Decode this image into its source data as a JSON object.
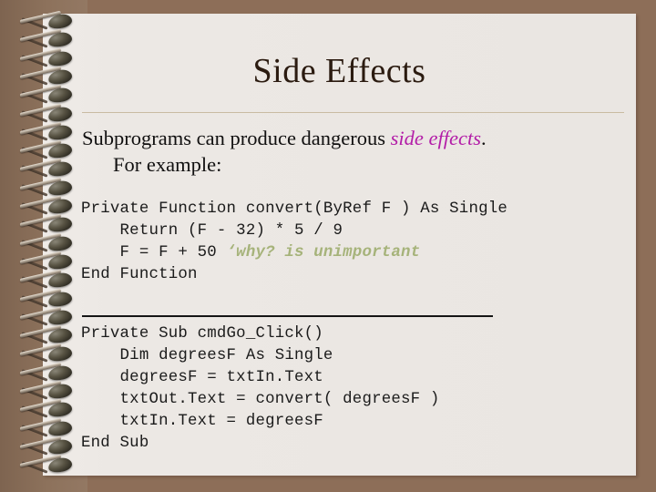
{
  "slide": {
    "title": "Side Effects",
    "colors": {
      "background_brown": "#8d6e58",
      "binding_brown": "#8a6f5a",
      "page": "#ece8e4",
      "title_text": "#2b1b10",
      "title_rule": "#c9bba2",
      "emphasis_magenta": "#b31ea8",
      "code_comment_green": "#a6b37a",
      "code_text": "#1b1b1b"
    }
  },
  "body": {
    "line1_before": "Subprograms can produce dangerous ",
    "line1_emphasis": "side effects",
    "line1_after": ".",
    "line2": "For example:"
  },
  "code_block_1": {
    "lines": [
      "Private Function convert(ByRef F ) As Single",
      "    Return (F - 32) * 5 / 9",
      "    F = F + 50 "
    ],
    "comment": "‘why? is unimportant",
    "last_line": "End Function"
  },
  "divider": {
    "label": "code-section-divider"
  },
  "code_block_2": {
    "lines": [
      "Private Sub cmdGo_Click()",
      "    Dim degreesF As Single",
      "    degreesF = txtIn.Text",
      "    txtOut.Text = convert( degreesF )",
      "    txtIn.Text = degreesF",
      "End Sub"
    ]
  },
  "binding": {
    "ring_count": 25,
    "icon": "spiral-ring-icon"
  }
}
